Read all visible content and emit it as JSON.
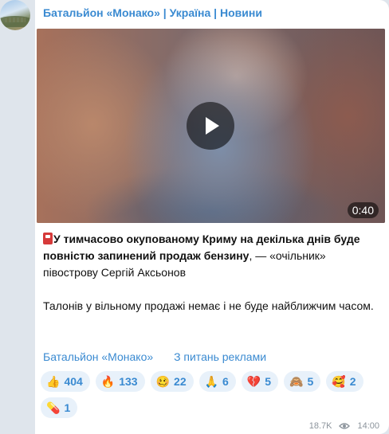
{
  "channel": {
    "name": "Батальйон «Монако» | Україна | Новини",
    "avatar_icon": "channel-avatar-landscape"
  },
  "video": {
    "duration": "0:40",
    "play_icon": "play-icon"
  },
  "post": {
    "emoji_icon": "fuel-pump-icon",
    "bold_text": "У тимчасово окупованому Криму на декілька днів буде повністю запинений продаж бензину",
    "rest_text": ", — «очільник» півострову Сергій Аксьонов",
    "paragraph2": "Талонів у вільному продажі немає і не буде найближчим часом."
  },
  "links": {
    "channel_link": "Батальйон «Монако»",
    "ads_link": "З питань реклами"
  },
  "reactions": [
    {
      "emoji": "👍",
      "count": "404",
      "icon": "thumbs-up-icon"
    },
    {
      "emoji": "🔥",
      "count": "133",
      "icon": "fire-icon"
    },
    {
      "emoji": "🥴",
      "count": "22",
      "icon": "woozy-face-icon"
    },
    {
      "emoji": "🙏",
      "count": "6",
      "icon": "praying-hands-icon"
    },
    {
      "emoji": "💔",
      "count": "5",
      "icon": "broken-heart-icon"
    },
    {
      "emoji": "🙈",
      "count": "5",
      "icon": "see-no-evil-monkey-icon"
    },
    {
      "emoji": "🥰",
      "count": "2",
      "icon": "smiling-hearts-icon"
    },
    {
      "emoji": "💊",
      "count": "1",
      "icon": "pill-icon"
    }
  ],
  "meta": {
    "views": "18.7K",
    "time": "14:00",
    "eye_icon": "eye-icon"
  },
  "colors": {
    "accent": "#3a8ad1",
    "bubble": "#ffffff",
    "background": "#dfe5ec",
    "reaction_bg": "#e8f1fa"
  }
}
